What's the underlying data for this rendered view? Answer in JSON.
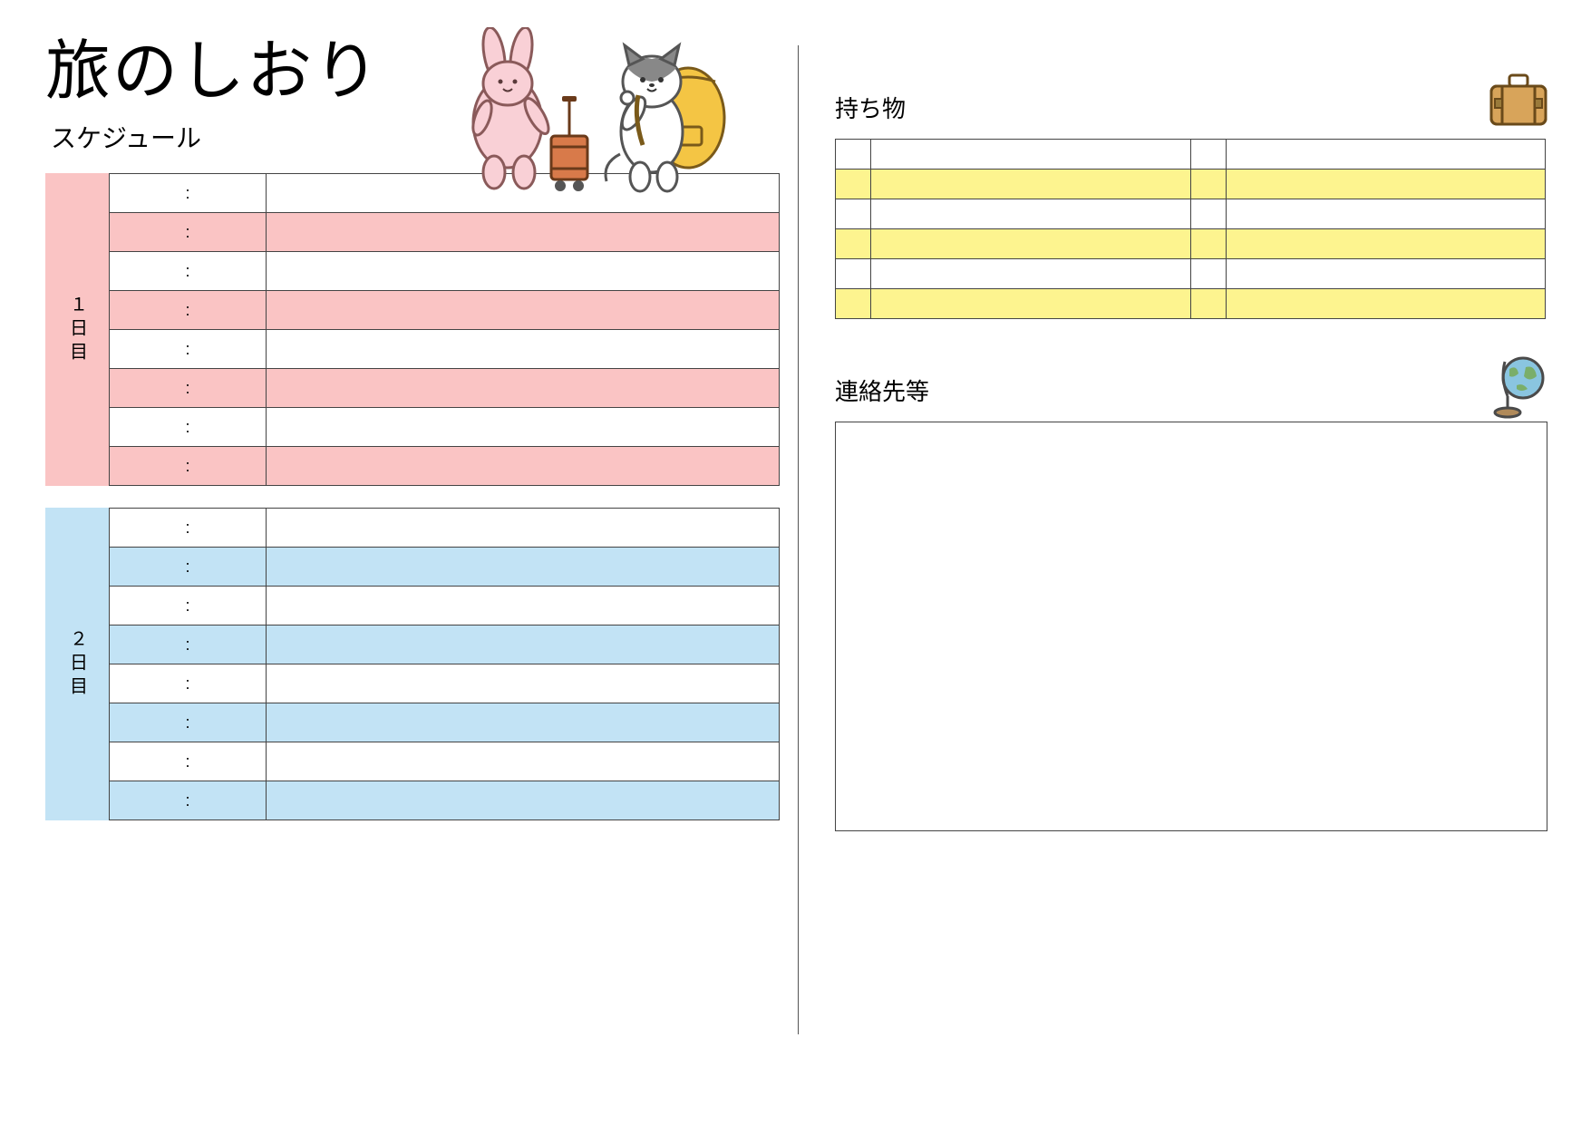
{
  "title": "旅のしおり",
  "schedule_label": "スケジュール",
  "days": [
    {
      "label": "１日目",
      "color": "#fac4c4",
      "rows": [
        {
          "time": ":",
          "desc": ""
        },
        {
          "time": ":",
          "desc": ""
        },
        {
          "time": ":",
          "desc": ""
        },
        {
          "time": ":",
          "desc": ""
        },
        {
          "time": ":",
          "desc": ""
        },
        {
          "time": ":",
          "desc": ""
        },
        {
          "time": ":",
          "desc": ""
        },
        {
          "time": ":",
          "desc": ""
        }
      ]
    },
    {
      "label": "２日目",
      "color": "#c2e3f5",
      "rows": [
        {
          "time": ":",
          "desc": ""
        },
        {
          "time": ":",
          "desc": ""
        },
        {
          "time": ":",
          "desc": ""
        },
        {
          "time": ":",
          "desc": ""
        },
        {
          "time": ":",
          "desc": ""
        },
        {
          "time": ":",
          "desc": ""
        },
        {
          "time": ":",
          "desc": ""
        },
        {
          "time": ":",
          "desc": ""
        }
      ]
    }
  ],
  "items_label": "持ち物",
  "items_rows": [
    {
      "c1": "",
      "i1": "",
      "c2": "",
      "i2": ""
    },
    {
      "c1": "",
      "i1": "",
      "c2": "",
      "i2": ""
    },
    {
      "c1": "",
      "i1": "",
      "c2": "",
      "i2": ""
    },
    {
      "c1": "",
      "i1": "",
      "c2": "",
      "i2": ""
    },
    {
      "c1": "",
      "i1": "",
      "c2": "",
      "i2": ""
    },
    {
      "c1": "",
      "i1": "",
      "c2": "",
      "i2": ""
    }
  ],
  "contact_label": "連絡先等",
  "contact_text": "",
  "icons": {
    "rabbit": "rabbit-with-suitcase",
    "cat": "cat-with-backpack",
    "suitcase": "suitcase-icon",
    "globe": "globe-icon"
  }
}
